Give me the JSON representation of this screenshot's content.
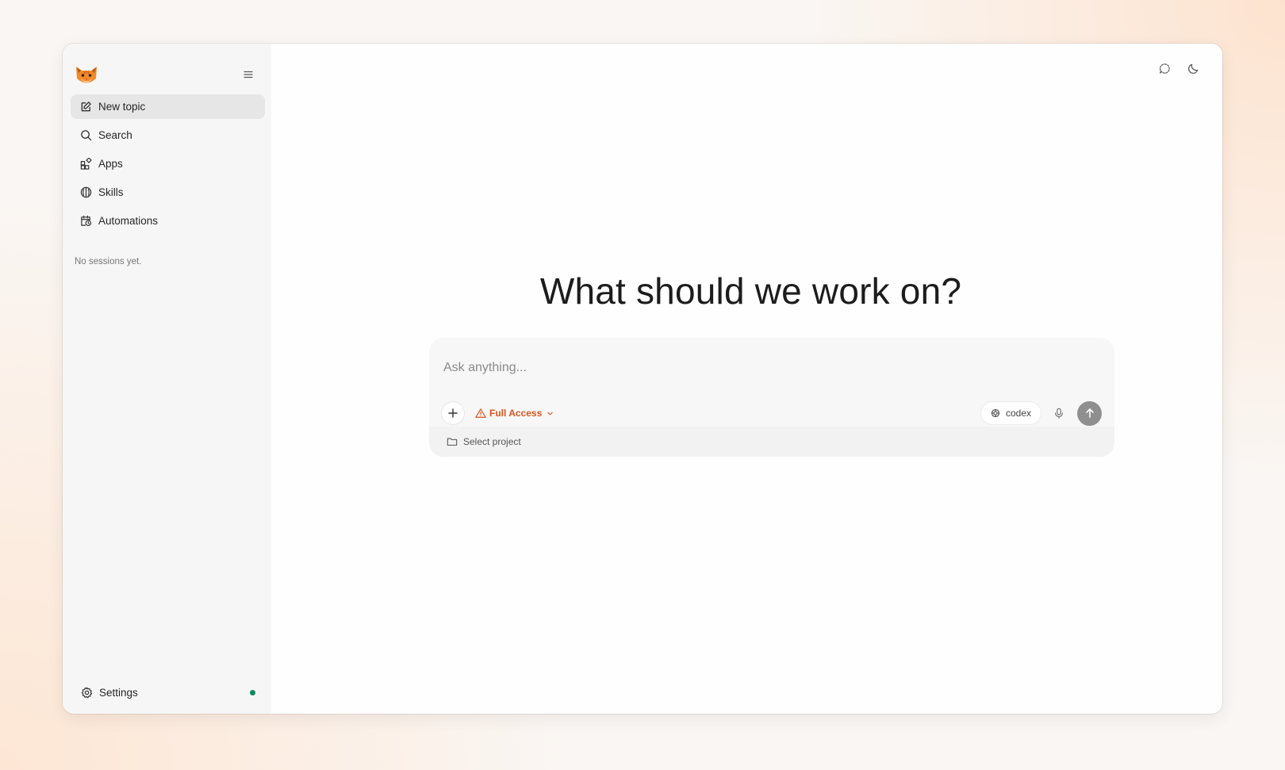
{
  "sidebar": {
    "logo": "cat-logo",
    "collapse_icon": "collapse-icon",
    "items": [
      {
        "label": "New topic",
        "icon": "edit-icon",
        "active": true
      },
      {
        "label": "Search",
        "icon": "search-icon"
      },
      {
        "label": "Apps",
        "icon": "apps-icon"
      },
      {
        "label": "Skills",
        "icon": "skills-icon"
      },
      {
        "label": "Automations",
        "icon": "calendar-clock-icon"
      }
    ],
    "empty_note": "No sessions yet.",
    "settings_label": "Settings",
    "status_color": "#0f8a5f"
  },
  "header": {
    "actions": [
      {
        "icon": "chat-bubble-icon"
      },
      {
        "icon": "moon-icon"
      }
    ]
  },
  "main": {
    "headline": "What should we work on?"
  },
  "composer": {
    "placeholder": "Ask anything...",
    "access_label": "Full Access",
    "access_color": "#d9541e",
    "model_label": "codex",
    "project_label": "Select project"
  }
}
